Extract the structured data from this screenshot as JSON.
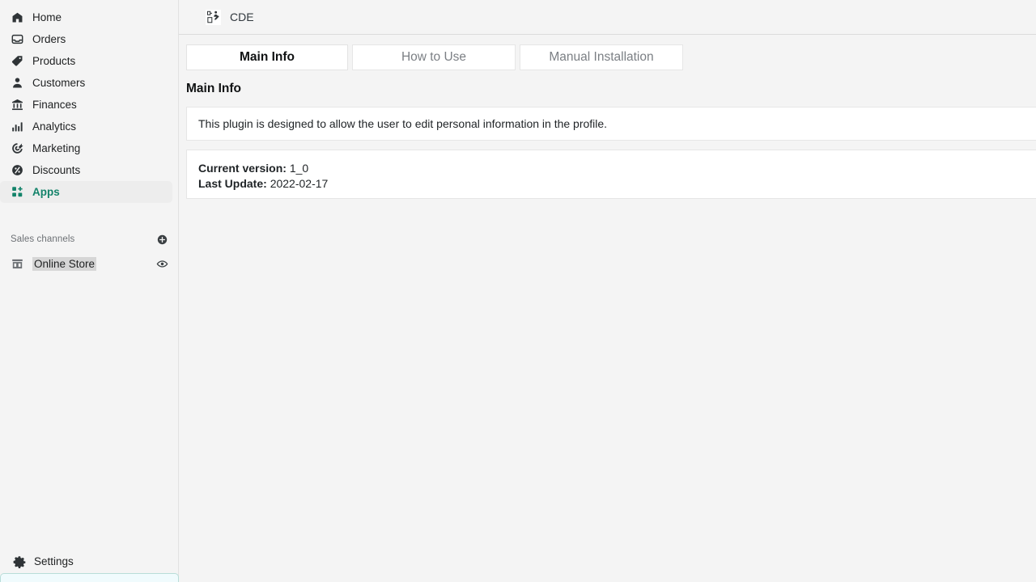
{
  "sidebar": {
    "items": [
      {
        "label": "Home",
        "icon": "home-icon",
        "active": false
      },
      {
        "label": "Orders",
        "icon": "orders-icon",
        "active": false
      },
      {
        "label": "Products",
        "icon": "tag-icon",
        "active": false
      },
      {
        "label": "Customers",
        "icon": "person-icon",
        "active": false
      },
      {
        "label": "Finances",
        "icon": "bank-icon",
        "active": false
      },
      {
        "label": "Analytics",
        "icon": "bar-chart-icon",
        "active": false
      },
      {
        "label": "Marketing",
        "icon": "target-icon",
        "active": false
      },
      {
        "label": "Discounts",
        "icon": "percent-icon",
        "active": false
      },
      {
        "label": "Apps",
        "icon": "apps-icon",
        "active": true
      }
    ],
    "sales_channels": {
      "title": "Sales channels",
      "add_icon": "plus-circle-icon",
      "channels": [
        {
          "label": "Online Store",
          "icon": "storefront-icon",
          "action_icon": "eye-icon"
        }
      ]
    },
    "settings": {
      "label": "Settings",
      "icon": "gear-icon"
    },
    "accent_color": "#13836a",
    "bottom_panel_color": "#f0fbfd"
  },
  "header": {
    "app_icon": "plugin-edit-icon",
    "title": "CDE"
  },
  "main": {
    "tabs": [
      {
        "label": "Main Info",
        "active": true
      },
      {
        "label": "How to Use",
        "active": false
      },
      {
        "label": "Manual Installation",
        "active": false
      }
    ],
    "section_heading": "Main Info",
    "description": "This plugin is designed to allow the user to edit personal information in the profile.",
    "version_info": {
      "current_version_label": "Current version:",
      "current_version_value": "1_0",
      "last_update_label": "Last Update:",
      "last_update_value": "2022-02-17"
    }
  }
}
